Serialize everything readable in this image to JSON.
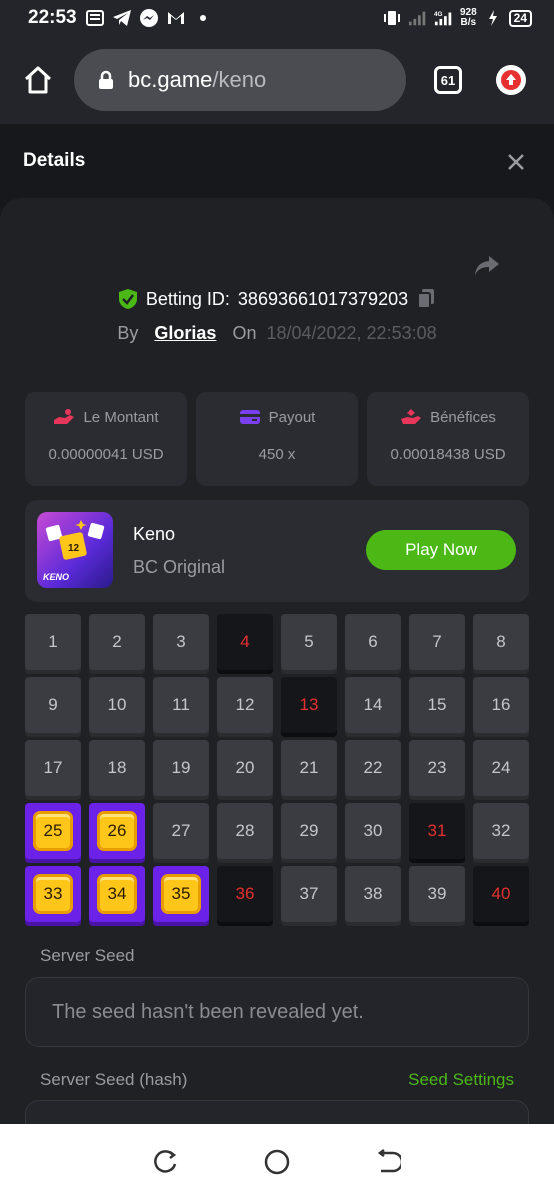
{
  "status_bar": {
    "time": "22:53",
    "speed_value": "928",
    "speed_unit": "B/s",
    "battery": "24"
  },
  "browser": {
    "url_host": "bc.game",
    "url_path": "/keno",
    "tab_count": "61"
  },
  "details": {
    "title": "Details"
  },
  "bet": {
    "betting_id_label": "Betting ID:",
    "betting_id": "38693661017379203",
    "by_label": "By",
    "user": "Glorias",
    "on_label": "On",
    "date": "18/04/2022, 22:53:08"
  },
  "stats": [
    {
      "label": "Le Montant",
      "value": "0.00000041 USD",
      "icon": "coin-hand-icon",
      "color": "#e8365a"
    },
    {
      "label": "Payout",
      "value": "450 x",
      "icon": "wallet-icon",
      "color": "#7b3ff2"
    },
    {
      "label": "Bénéfices",
      "value": "0.00018438 USD",
      "icon": "profit-hand-icon",
      "color": "#e8365a"
    }
  ],
  "game": {
    "name": "Keno",
    "provider": "BC Original",
    "thumb_label": "KENO",
    "play_label": "Play Now"
  },
  "grid": {
    "numbers": [
      "1",
      "2",
      "3",
      "4",
      "5",
      "6",
      "7",
      "8",
      "9",
      "10",
      "11",
      "12",
      "13",
      "14",
      "15",
      "16",
      "17",
      "18",
      "19",
      "20",
      "21",
      "22",
      "23",
      "24",
      "25",
      "26",
      "27",
      "28",
      "29",
      "30",
      "31",
      "32",
      "33",
      "34",
      "35",
      "36",
      "37",
      "38",
      "39",
      "40"
    ],
    "hits": [
      "25",
      "26",
      "33",
      "34",
      "35"
    ],
    "misses": [
      "4",
      "13",
      "31",
      "36",
      "40"
    ]
  },
  "server_seed": {
    "label": "Server Seed",
    "value": "The seed hasn't been revealed yet."
  },
  "server_seed_hash": {
    "label": "Server Seed (hash)",
    "settings_label": "Seed Settings"
  },
  "colors": {
    "accent_green": "#4bb815",
    "hit_purple": "#6b21e8",
    "miss_red": "#e5302f"
  }
}
